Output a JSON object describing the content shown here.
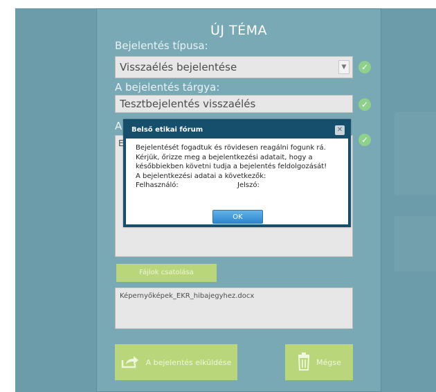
{
  "form": {
    "title": "ÚJ TÉMA",
    "type_label": "Bejelentés típusa:",
    "type_value": "Visszaélés bejelentése",
    "subject_label": "A bejelentés tárgya:",
    "subject_value": "Tesztbejelentés visszaélés",
    "text_label_partial": "A",
    "text_value_partial": "Ez",
    "attach_button": "Fájlok csatolása",
    "attached_file": "Képernyőképek_EKR_hibajegyhez.docx",
    "submit_button": "A bejelentés elküldése",
    "cancel_button": "Mégse"
  },
  "modal": {
    "title": "Belső etikai fórum",
    "lines": [
      "Bejelentését fogadtuk és rövidesen reagálni fogunk rá.",
      "Kérjük, őrizze meg a bejelentkezési adatait, hogy a",
      "későbbiekben követni tudja a bejelentés feldolgozását!",
      "A bejelentkezési adatai a következők:"
    ],
    "user_label": "Felhasználó:",
    "password_label": "Jelszó:",
    "ok_button": "OK",
    "close_symbol": "✕"
  },
  "icons": [
    "check-icon",
    "chevron-down-icon",
    "share-icon",
    "trash-icon",
    "close-icon"
  ],
  "colors": {
    "background": "#6c9ba9",
    "panel": "#7aa9b6",
    "accent_green": "#b9d77a",
    "check_green": "#8fd08b",
    "modal_header": "#154f6b",
    "ok_blue": "#2c86cf"
  }
}
